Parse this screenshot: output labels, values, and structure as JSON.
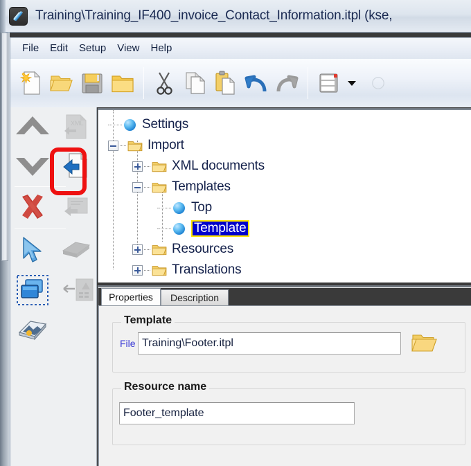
{
  "window": {
    "title": "Training\\Training_IF400_invoice_Contact_Information.itpl (kse,",
    "app_icon": "comet-icon"
  },
  "menubar": {
    "items": [
      {
        "label": "File"
      },
      {
        "label": "Edit"
      },
      {
        "label": "Setup"
      },
      {
        "label": "View"
      },
      {
        "label": "Help"
      }
    ]
  },
  "toolbar": {
    "buttons": [
      {
        "name": "new-document-button",
        "icon": "new-document-icon"
      },
      {
        "name": "open-folder-button",
        "icon": "open-folder-icon"
      },
      {
        "name": "save-button",
        "icon": "floppy-save-icon"
      },
      {
        "name": "open-file-button",
        "icon": "folder-icon"
      },
      {
        "name": "cut-button",
        "icon": "scissors-icon"
      },
      {
        "name": "copy-button",
        "icon": "copy-pages-icon"
      },
      {
        "name": "paste-button",
        "icon": "clipboard-paste-icon"
      },
      {
        "name": "undo-button",
        "icon": "undo-arrow-icon"
      },
      {
        "name": "redo-button",
        "icon": "redo-arrow-icon"
      },
      {
        "name": "layout-button",
        "icon": "form-layout-icon"
      },
      {
        "name": "layout-dropdown-button",
        "icon": "chevron-down-icon"
      }
    ]
  },
  "left_toolbar": {
    "buttons": [
      {
        "name": "move-up-button",
        "icon": "chevron-up-icon",
        "enabled": true
      },
      {
        "name": "import-xml-button",
        "icon": "xml-document-arrow-icon",
        "enabled": false
      },
      {
        "name": "move-down-button",
        "icon": "chevron-down-thick-icon",
        "enabled": true
      },
      {
        "name": "import-template-button",
        "icon": "document-left-arrow-icon",
        "enabled": true,
        "highlighted": true
      },
      {
        "name": "delete-button",
        "icon": "red-x-icon",
        "enabled": true
      },
      {
        "name": "import-block-button",
        "icon": "block-arrow-icon",
        "enabled": false
      },
      {
        "name": "select-pointer-button",
        "icon": "arrow-cursor-icon",
        "enabled": true
      },
      {
        "name": "book-button",
        "icon": "book-icon",
        "enabled": false
      },
      {
        "name": "duplicate-layers-button",
        "icon": "stacked-windows-icon",
        "enabled": true,
        "selected": true
      },
      {
        "name": "import-resource-button",
        "icon": "left-arrow-page-icon",
        "enabled": false
      },
      {
        "name": "scan-button",
        "icon": "scanner-photo-icon",
        "enabled": true
      }
    ]
  },
  "tree": {
    "nodes": [
      {
        "label": "Settings",
        "depth": 0,
        "icon": "sphere-node-icon",
        "toggle": "none",
        "selected": false
      },
      {
        "label": "Import",
        "depth": 0,
        "icon": "folder-open-icon",
        "toggle": "minus",
        "selected": false
      },
      {
        "label": "XML documents",
        "depth": 1,
        "icon": "folder-open-icon",
        "toggle": "plus",
        "selected": false
      },
      {
        "label": "Templates",
        "depth": 1,
        "icon": "folder-open-icon",
        "toggle": "minus",
        "selected": false
      },
      {
        "label": "Top",
        "depth": 2,
        "icon": "sphere-node-icon",
        "toggle": "none",
        "selected": false
      },
      {
        "label": "Template",
        "depth": 2,
        "icon": "sphere-node-icon",
        "toggle": "none",
        "selected": true
      },
      {
        "label": "Resources",
        "depth": 1,
        "icon": "folder-open-icon",
        "toggle": "plus",
        "selected": false
      },
      {
        "label": "Translations",
        "depth": 1,
        "icon": "folder-open-icon",
        "toggle": "plus",
        "selected": false
      }
    ]
  },
  "properties": {
    "tabs": [
      {
        "label": "Properties",
        "active": true
      },
      {
        "label": "Description",
        "active": false
      }
    ],
    "template_group": {
      "title": "Template",
      "file_label": "File",
      "file_value": "Training\\Footer.itpl",
      "file_placeholder": "",
      "browse_icon": "open-folder-icon"
    },
    "resource_group": {
      "title": "Resource name",
      "value": "Footer_template",
      "placeholder": ""
    }
  },
  "annotation": {
    "highlight_color": "#ee1111",
    "target": "import-template-button"
  },
  "colors": {
    "selection_bg": "#0000cc",
    "selection_border": "#ffe400",
    "title_text": "#1a2a52",
    "label_blue": "#3b3bd6"
  }
}
